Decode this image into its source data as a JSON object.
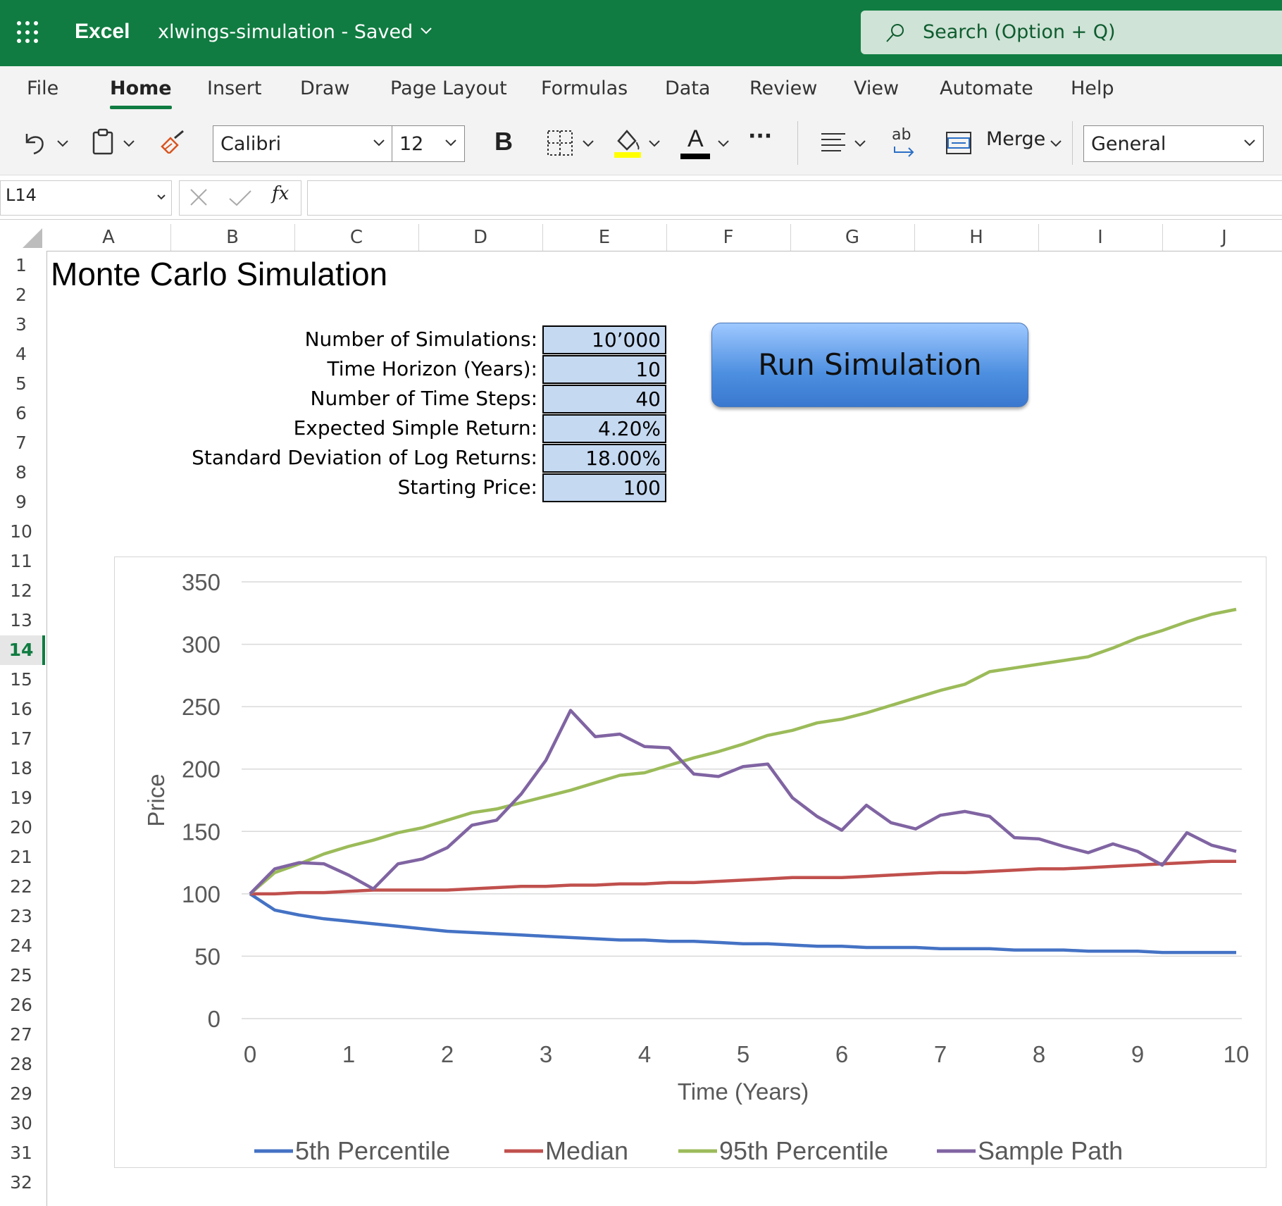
{
  "app": {
    "name": "Excel",
    "doc_title": "xlwings-simulation  -  Saved",
    "search_placeholder": "Search (Option + Q)"
  },
  "ribbon": {
    "tabs": [
      {
        "label": "File"
      },
      {
        "label": "Home"
      },
      {
        "label": "Insert"
      },
      {
        "label": "Draw"
      },
      {
        "label": "Page Layout"
      },
      {
        "label": "Formulas"
      },
      {
        "label": "Data"
      },
      {
        "label": "Review"
      },
      {
        "label": "View"
      },
      {
        "label": "Automate"
      },
      {
        "label": "Help"
      }
    ],
    "active_tab": "Home",
    "font_name": "Calibri",
    "font_size": "12",
    "bold_label": "B",
    "font_color_label": "A",
    "more_label": "···",
    "wrap_label": "ab",
    "merge_label": "Merge",
    "number_format": "General",
    "fill_color": "#ffff00",
    "font_color": "#000000",
    "accent": "#107c41"
  },
  "formula_bar": {
    "cell_ref": "L14",
    "fx_label": "fx",
    "formula": ""
  },
  "grid": {
    "columns": [
      "A",
      "B",
      "C",
      "D",
      "E",
      "F",
      "G",
      "H",
      "I",
      "J"
    ],
    "rows": [
      "1",
      "2",
      "3",
      "4",
      "5",
      "6",
      "7",
      "8",
      "9",
      "10",
      "11",
      "12",
      "13",
      "14",
      "15",
      "16",
      "17",
      "18",
      "19",
      "20",
      "21",
      "22",
      "23",
      "24",
      "25",
      "26",
      "27",
      "28",
      "29",
      "30",
      "31",
      "32"
    ],
    "selected_row": "14"
  },
  "sheet": {
    "title": "Monte Carlo Simulation",
    "params": [
      {
        "label": "Number of Simulations:",
        "value": "10’000"
      },
      {
        "label": "Time Horizon (Years):",
        "value": "10"
      },
      {
        "label": "Number of Time Steps:",
        "value": "40"
      },
      {
        "label": "Expected Simple Return:",
        "value": "4.20%"
      },
      {
        "label": "Standard Deviation of Log Returns:",
        "value": "18.00%"
      },
      {
        "label": "Starting Price:",
        "value": "100"
      }
    ],
    "param_cell_color": "#c5d9f1",
    "run_button_label": "Run Simulation"
  },
  "chart_data": {
    "type": "line",
    "title": "",
    "xlabel": "Time (Years)",
    "ylabel": "Price",
    "xlim": [
      0,
      10
    ],
    "ylim": [
      0,
      350
    ],
    "xticks": [
      0,
      1,
      2,
      3,
      4,
      5,
      6,
      7,
      8,
      9,
      10
    ],
    "yticks": [
      0,
      50,
      100,
      150,
      200,
      250,
      300,
      350
    ],
    "grid": true,
    "legend_position": "bottom",
    "x": [
      0,
      0.25,
      0.5,
      0.75,
      1,
      1.25,
      1.5,
      1.75,
      2,
      2.25,
      2.5,
      2.75,
      3,
      3.25,
      3.5,
      3.75,
      4,
      4.25,
      4.5,
      4.75,
      5,
      5.25,
      5.5,
      5.75,
      6,
      6.25,
      6.5,
      6.75,
      7,
      7.25,
      7.5,
      7.75,
      8,
      8.25,
      8.5,
      8.75,
      9,
      9.25,
      9.5,
      9.75,
      10
    ],
    "series": [
      {
        "name": "5th Percentile",
        "color": "#4472c4",
        "values": [
          100,
          87,
          83,
          80,
          78,
          76,
          74,
          72,
          70,
          69,
          68,
          67,
          66,
          65,
          64,
          63,
          63,
          62,
          62,
          61,
          60,
          60,
          59,
          58,
          58,
          57,
          57,
          57,
          56,
          56,
          56,
          55,
          55,
          55,
          54,
          54,
          54,
          53,
          53,
          53,
          53
        ]
      },
      {
        "name": "Median",
        "color": "#c0504d",
        "values": [
          100,
          100,
          101,
          101,
          102,
          103,
          103,
          103,
          103,
          104,
          105,
          106,
          106,
          107,
          107,
          108,
          108,
          109,
          109,
          110,
          111,
          112,
          113,
          113,
          113,
          114,
          115,
          116,
          117,
          117,
          118,
          119,
          120,
          120,
          121,
          122,
          123,
          124,
          125,
          126,
          126
        ]
      },
      {
        "name": "95th Percentile",
        "color": "#9bbb59",
        "values": [
          100,
          117,
          124,
          132,
          138,
          143,
          149,
          153,
          159,
          165,
          168,
          173,
          178,
          183,
          189,
          195,
          197,
          203,
          209,
          214,
          220,
          227,
          231,
          237,
          240,
          245,
          251,
          257,
          263,
          268,
          278,
          281,
          284,
          287,
          290,
          297,
          305,
          311,
          318,
          324,
          328
        ]
      },
      {
        "name": "Sample Path",
        "color": "#8064a2",
        "values": [
          100,
          120,
          125,
          124,
          115,
          104,
          124,
          128,
          137,
          155,
          159,
          180,
          207,
          247,
          226,
          228,
          218,
          217,
          196,
          194,
          202,
          204,
          177,
          162,
          151,
          171,
          157,
          152,
          163,
          166,
          162,
          145,
          144,
          138,
          133,
          140,
          134,
          123,
          149,
          139,
          134
        ]
      }
    ]
  }
}
